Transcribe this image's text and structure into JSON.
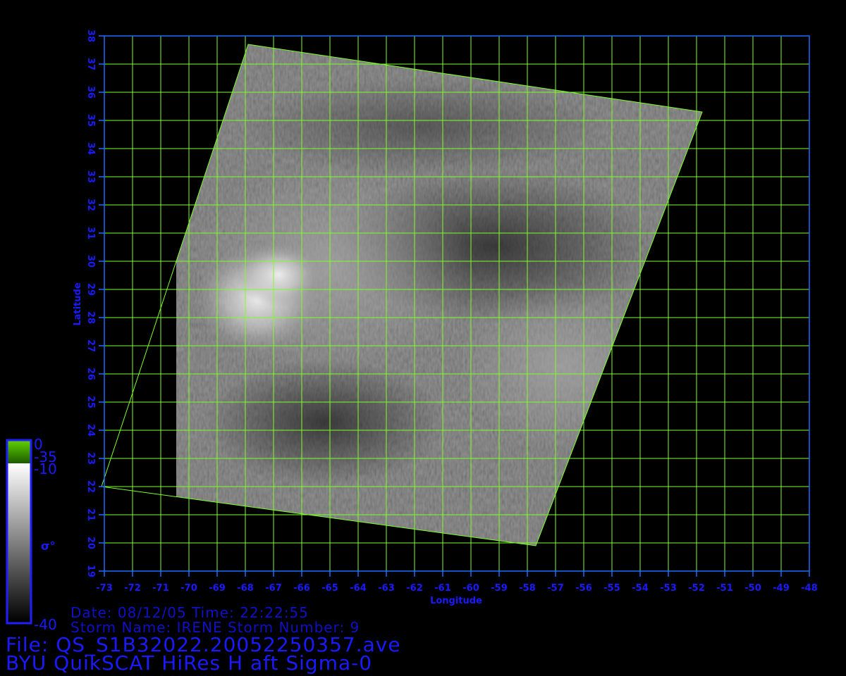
{
  "map": {
    "axes": {
      "x_label": "Longitude",
      "y_label": "Latitude",
      "x_range": [
        -73,
        -48
      ],
      "y_range": [
        19,
        38
      ],
      "x_ticks": [
        "-73",
        "-72",
        "-71",
        "-70",
        "-69",
        "-68",
        "-67",
        "-66",
        "-65",
        "-64",
        "-63",
        "-62",
        "-61",
        "-60",
        "-59",
        "-58",
        "-57",
        "-56",
        "-55",
        "-54",
        "-53",
        "-52",
        "-51",
        "-50",
        "-49",
        "-48"
      ],
      "y_ticks": [
        "19",
        "20",
        "21",
        "22",
        "23",
        "24",
        "25",
        "26",
        "27",
        "28",
        "29",
        "30",
        "31",
        "32",
        "33",
        "34",
        "35",
        "36",
        "37",
        "38"
      ]
    },
    "swath_corners_lonlat": [
      [
        -67.9,
        37.7
      ],
      [
        -51.8,
        35.3
      ],
      [
        -57.7,
        19.9
      ],
      [
        -73.1,
        22.0
      ]
    ],
    "colors": {
      "grid": "#7cff2a",
      "frame": "#1e6bff",
      "axis_text": "#1a1aff",
      "background": "#000000"
    }
  },
  "colorbar": {
    "label": "σ°",
    "labels": {
      "top": "0",
      "green_bottom": "-35",
      "gray_top": "-10",
      "bottom": "-40"
    },
    "gradient_colors": {
      "green": "#3aa000",
      "light": "#ffffff",
      "dark": "#000000"
    }
  },
  "info": {
    "line1": "Date: 08/12/05   Time: 22:22:55",
    "line2": "Storm  Name: IRENE   Storm  Number: 9",
    "line3": "File:  QS_S1B32022.20052250357.ave",
    "line4": "BYU  QuikSCAT  HiRes  H  aft  Sigma-0"
  }
}
